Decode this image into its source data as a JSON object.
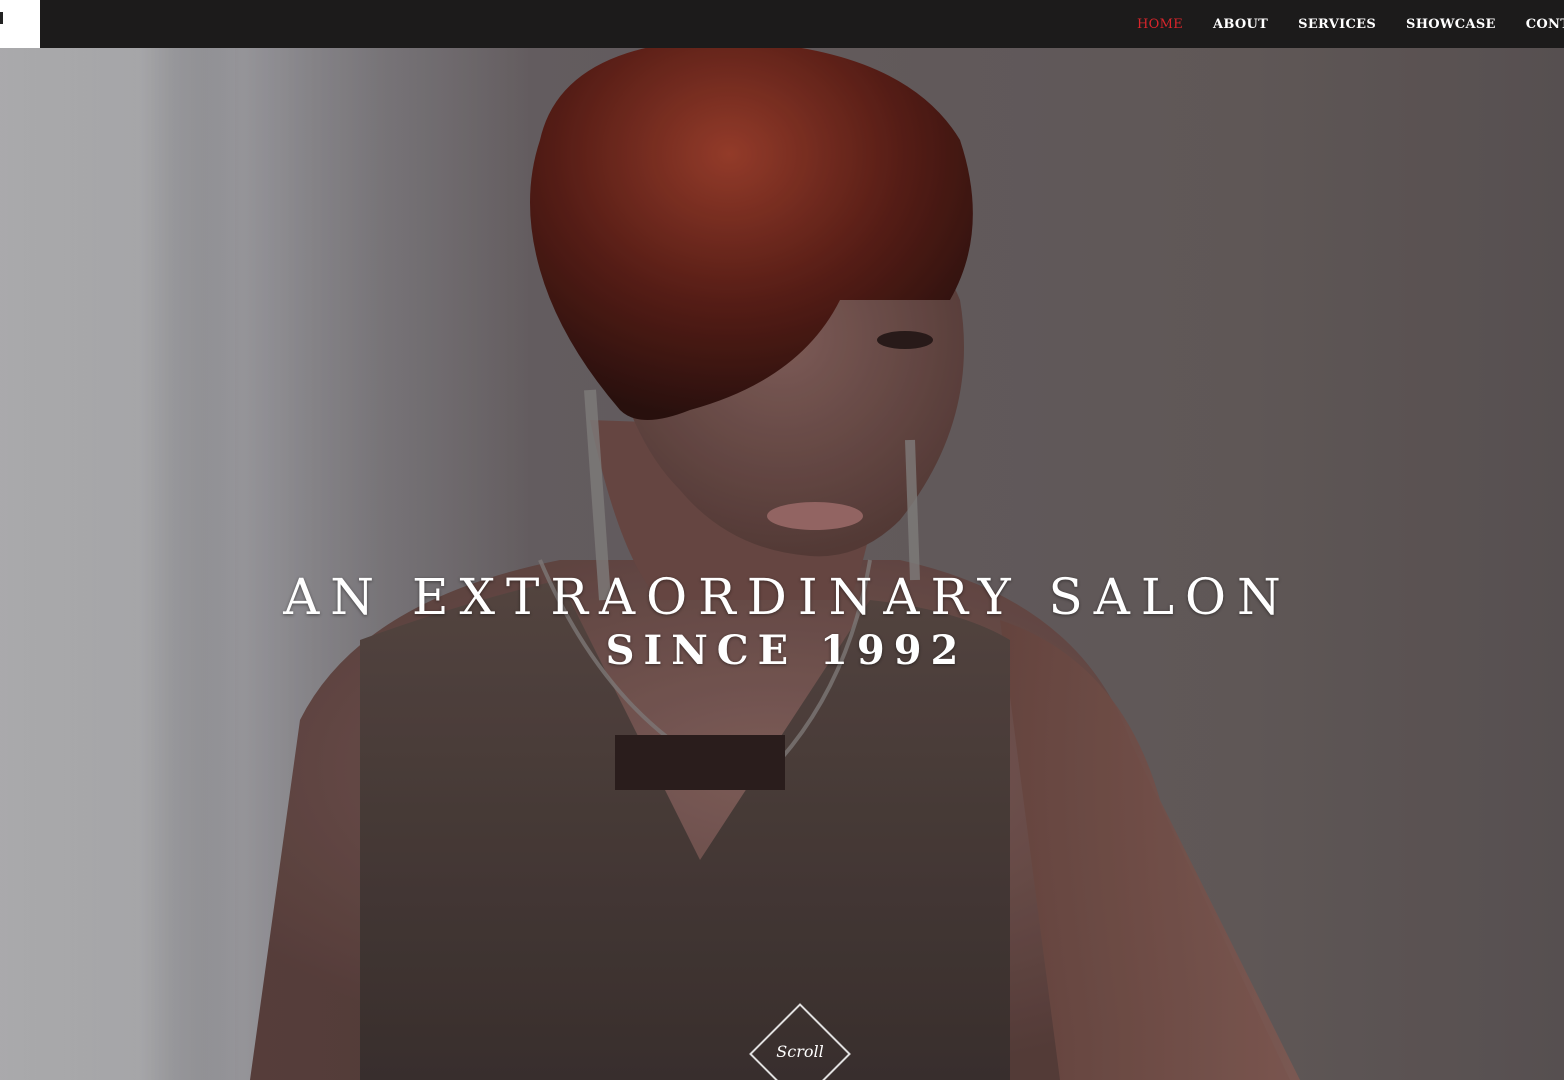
{
  "navbar": {
    "items": [
      {
        "label": "HOME",
        "active": true
      },
      {
        "label": "ABOUT",
        "active": false
      },
      {
        "label": "SERVICES",
        "active": false
      },
      {
        "label": "SHOWCASE",
        "active": false
      },
      {
        "label": "CONTACT",
        "active": false
      }
    ],
    "active_color": "#d8252b"
  },
  "hero": {
    "headline": "AN EXTRAORDINARY SALON",
    "subheadline": "SINCE 1992",
    "scroll_label": "Scroll"
  }
}
